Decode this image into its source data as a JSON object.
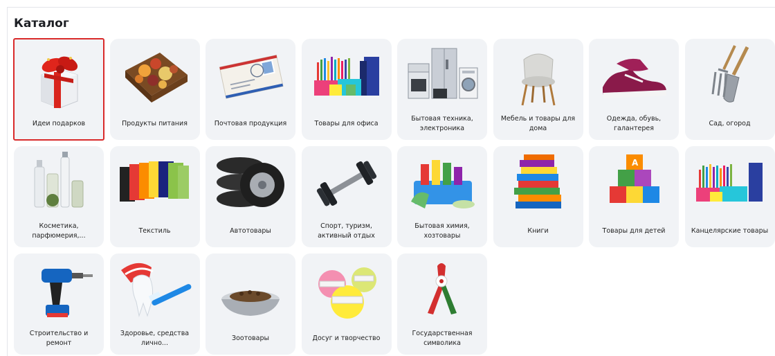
{
  "catalog": {
    "title": "Каталог",
    "items": [
      {
        "label": "Идеи подарков",
        "icon": "gift-box-icon",
        "selected": true
      },
      {
        "label": "Продукты питания",
        "icon": "dried-fruit-tray-icon"
      },
      {
        "label": "Почтовая продукция",
        "icon": "envelope-icon"
      },
      {
        "label": "Товары для офиса",
        "icon": "office-supplies-icon"
      },
      {
        "label": "Бытовая техника, электроника",
        "icon": "home-appliances-icon"
      },
      {
        "label": "Мебель и товары для дома",
        "icon": "chair-icon"
      },
      {
        "label": "Одежда, обувь, галантерея",
        "icon": "sneaker-icon"
      },
      {
        "label": "Сад, огород",
        "icon": "garden-tools-icon"
      },
      {
        "label": "Косметика, парфюмерия,...",
        "icon": "cosmetics-bottles-icon"
      },
      {
        "label": "Текстиль",
        "icon": "t-shirts-icon"
      },
      {
        "label": "Автотовары",
        "icon": "car-tires-icon"
      },
      {
        "label": "Спорт, туризм, активный отдых",
        "icon": "dumbbell-icon"
      },
      {
        "label": "Бытовая химия, хозтовары",
        "icon": "cleaning-supplies-icon"
      },
      {
        "label": "Книги",
        "icon": "books-stack-icon"
      },
      {
        "label": "Товары для детей",
        "icon": "toy-blocks-icon"
      },
      {
        "label": "Канцелярские товары",
        "icon": "stationery-icon"
      },
      {
        "label": "Строительство и ремонт",
        "icon": "power-drill-icon"
      },
      {
        "label": "Здоровье, средства лично...",
        "icon": "tooth-toothbrush-icon"
      },
      {
        "label": "Зоотовары",
        "icon": "pet-bowl-icon"
      },
      {
        "label": "Досуг и творчество",
        "icon": "yarn-balls-icon"
      },
      {
        "label": "Государственная символика",
        "icon": "national-ribbon-icon"
      }
    ]
  }
}
